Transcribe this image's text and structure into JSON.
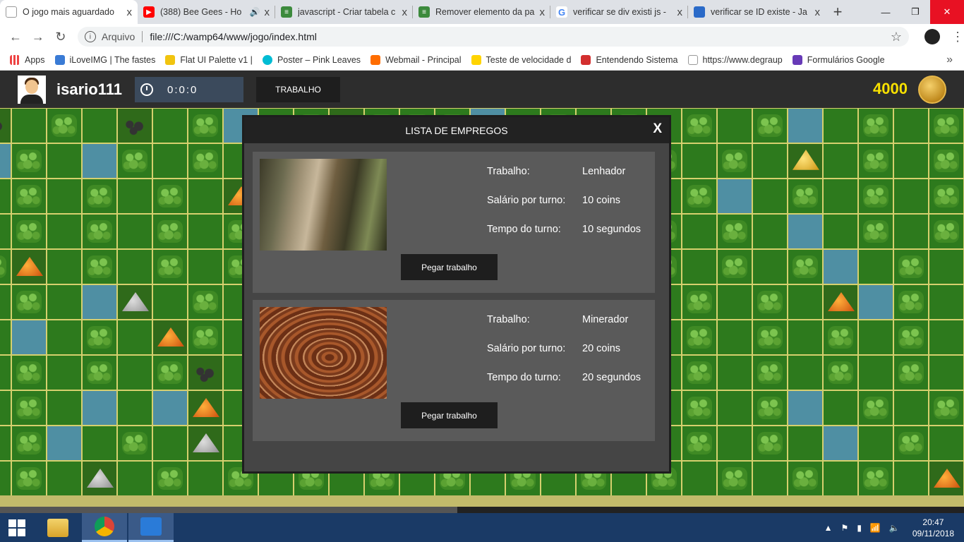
{
  "browser": {
    "tabs": [
      {
        "title": "O jogo mais aguardado",
        "icon": "page-icon",
        "color": "#ffffff",
        "active": true
      },
      {
        "title": "(388) Bee Gees - Ho",
        "icon": "youtube-icon",
        "color": "#ff0000",
        "active": false
      },
      {
        "title": "javascript - Criar tabela c",
        "icon": "stackoverflow-icon",
        "color": "#3c8a3c",
        "active": false
      },
      {
        "title": "Remover elemento da pa",
        "icon": "stackoverflow-icon",
        "color": "#3c8a3c",
        "active": false
      },
      {
        "title": "verificar se div existi js -",
        "icon": "google-icon",
        "color": "#4285f4",
        "active": false
      },
      {
        "title": "verificar se ID existe - Ja",
        "icon": "cube-icon",
        "color": "#2a6ac8",
        "active": false
      }
    ],
    "tab_close": "x",
    "new_tab": "+",
    "address": {
      "scheme": "Arquivo",
      "url": "file:///C:/wamp64/www/jogo/index.html"
    },
    "bookmarks": [
      {
        "label": "Apps",
        "color": "#e44"
      },
      {
        "label": "iLoveIMG | The fastes",
        "color": "#3a7bd5"
      },
      {
        "label": "Flat UI Palette v1 |",
        "color": "#f1c40f"
      },
      {
        "label": "Poster – Pink Leaves",
        "color": "#00bcd4"
      },
      {
        "label": "Webmail - Principal",
        "color": "#ff6d00"
      },
      {
        "label": "Teste de velocidade d",
        "color": "#ffd400"
      },
      {
        "label": "Entendendo Sistema",
        "color": "#d32f2f"
      },
      {
        "label": "https://www.degraup",
        "color": "#bbbbbb"
      },
      {
        "label": "Formulários Google",
        "color": "#673ab7"
      }
    ]
  },
  "game": {
    "username": "isario111",
    "timer": "0:0:0",
    "work_button": "TRABALHO",
    "coins": "4000"
  },
  "modal": {
    "title": "LISTA DE EMPREGOS",
    "close": "X",
    "jobs": [
      {
        "image": "forest-logging-photo",
        "rows": [
          {
            "label": "Trabalho:",
            "value": "Lenhador"
          },
          {
            "label": "Salário por turno:",
            "value": "10 coins"
          },
          {
            "label": "Tempo do turno:",
            "value": "10 segundos"
          }
        ],
        "button": "Pegar trabalho"
      },
      {
        "image": "open-pit-mine-photo",
        "rows": [
          {
            "label": "Trabalho:",
            "value": "Minerador"
          },
          {
            "label": "Salário por turno:",
            "value": "20 coins"
          },
          {
            "label": "Tempo do turno:",
            "value": "20 segundos"
          }
        ],
        "button": "Pegar trabalho"
      }
    ]
  },
  "taskbar": {
    "apps": [
      "file-explorer-icon",
      "chrome-icon",
      "vscode-icon"
    ],
    "time": "20:47",
    "date": "09/11/2018"
  }
}
